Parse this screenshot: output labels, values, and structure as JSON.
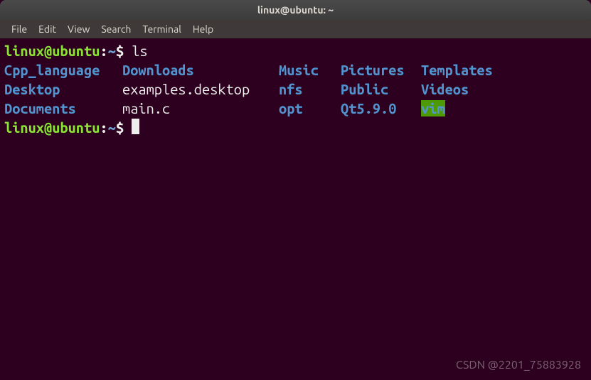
{
  "window": {
    "title": "linux@ubuntu: ~"
  },
  "menu": {
    "file": "File",
    "edit": "Edit",
    "view": "View",
    "search": "Search",
    "terminal": "Terminal",
    "help": "Help"
  },
  "prompt": {
    "user": "linux",
    "at": "@",
    "host": "ubuntu",
    "colon": ":",
    "path": "~",
    "dollar": "$"
  },
  "commands": {
    "ls": "ls"
  },
  "ls_output": {
    "rows": [
      {
        "c1": "Cpp_language",
        "c2": "Downloads",
        "c3": "Music",
        "c4": "Pictures",
        "c5": "Templates"
      },
      {
        "c1": "Desktop",
        "c2": "examples.desktop",
        "c3": "nfs",
        "c4": "Public",
        "c5": "Videos"
      },
      {
        "c1": "Documents",
        "c2": "main.c",
        "c3": "opt",
        "c4": "Qt5.9.0",
        "c5": "vim"
      }
    ]
  },
  "watermark": "CSDN @2201_75883928"
}
